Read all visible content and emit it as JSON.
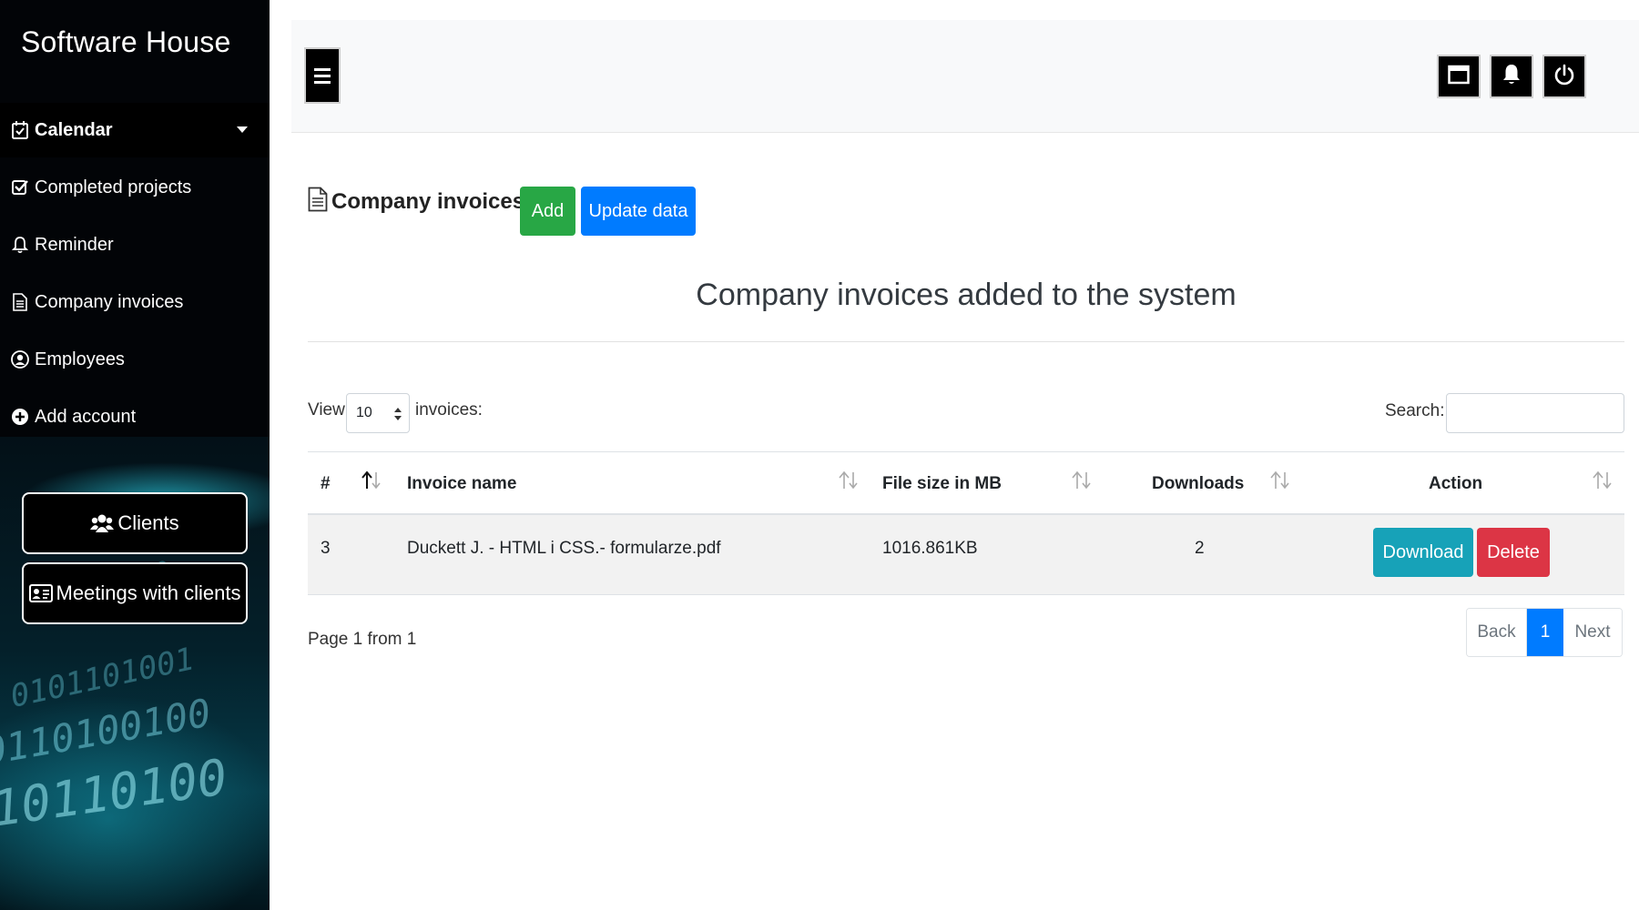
{
  "sidebar": {
    "brand": "Software House",
    "items": [
      {
        "label": "Calendar",
        "icon": "calendar-check-icon"
      },
      {
        "label": "Completed projects",
        "icon": "check-square-icon"
      },
      {
        "label": "Reminder",
        "icon": "bell-icon"
      },
      {
        "label": "Company invoices",
        "icon": "file-icon"
      },
      {
        "label": "Employees",
        "icon": "user-circle-icon"
      },
      {
        "label": "Add account",
        "icon": "plus-circle-icon"
      }
    ],
    "buttons": [
      {
        "label": "Clients",
        "icon": "users-icon"
      },
      {
        "label": "Meetings with clients",
        "icon": "id-card-icon"
      }
    ]
  },
  "topbar": {
    "icons": [
      "window-icon",
      "bell-icon",
      "power-icon"
    ]
  },
  "main": {
    "heading": "Company invoices:",
    "add_label": "Add",
    "update_label": "Update data",
    "section_title": "Company invoices added to the system",
    "view_prefix": "View",
    "page_length": "10",
    "view_suffix": "invoices:",
    "search_label": "Search:",
    "search_value": "",
    "columns": [
      "#",
      "Invoice name",
      "File size in MB",
      "Downloads",
      "Action"
    ],
    "rows": [
      {
        "id": "3",
        "name": "Duckett J. - HTML i CSS.- formularze.pdf",
        "size": "1016.861KB",
        "downloads": "2"
      }
    ],
    "download_label": "Download",
    "delete_label": "Delete",
    "page_info": "Page 1 from 1",
    "pagination": {
      "back": "Back",
      "current": "1",
      "next": "Next"
    }
  },
  "colors": {
    "add": "#28a745",
    "update": "#007bff",
    "download": "#17a2b8",
    "delete": "#dc3545"
  }
}
